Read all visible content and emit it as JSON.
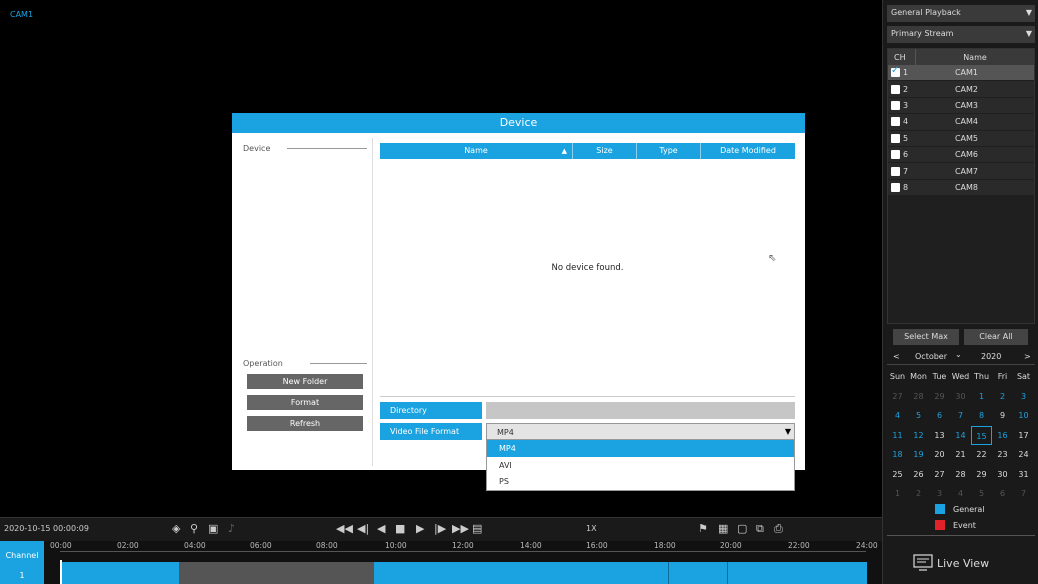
{
  "video": {
    "cam_label": "CAM1"
  },
  "right_panel": {
    "playback_mode": "General Playback",
    "stream": "Primary Stream",
    "table_headers": {
      "ch": "CH",
      "name": "Name"
    },
    "channels": [
      {
        "num": "1",
        "name": "CAM1",
        "checked": true
      },
      {
        "num": "2",
        "name": "CAM2",
        "checked": false
      },
      {
        "num": "3",
        "name": "CAM3",
        "checked": false
      },
      {
        "num": "4",
        "name": "CAM4",
        "checked": false
      },
      {
        "num": "5",
        "name": "CAM5",
        "checked": false
      },
      {
        "num": "6",
        "name": "CAM6",
        "checked": false
      },
      {
        "num": "7",
        "name": "CAM7",
        "checked": false
      },
      {
        "num": "8",
        "name": "CAM8",
        "checked": false
      }
    ],
    "select_max": "Select Max",
    "clear_all": "Clear All",
    "calendar": {
      "prev": "<",
      "month": "October",
      "year": "2020",
      "next": ">",
      "day_headers": [
        "Sun",
        "Mon",
        "Tue",
        "Wed",
        "Thu",
        "Fri",
        "Sat"
      ],
      "days": [
        {
          "d": "27",
          "s": "off"
        },
        {
          "d": "28",
          "s": "off"
        },
        {
          "d": "29",
          "s": "off"
        },
        {
          "d": "30",
          "s": "off"
        },
        {
          "d": "1",
          "s": "blue"
        },
        {
          "d": "2",
          "s": "blue"
        },
        {
          "d": "3",
          "s": "blue"
        },
        {
          "d": "4",
          "s": "blue"
        },
        {
          "d": "5",
          "s": "blue"
        },
        {
          "d": "6",
          "s": "blue"
        },
        {
          "d": "7",
          "s": "blue"
        },
        {
          "d": "8",
          "s": "blue"
        },
        {
          "d": "9",
          "s": "normal"
        },
        {
          "d": "10",
          "s": "blue"
        },
        {
          "d": "11",
          "s": "blue"
        },
        {
          "d": "12",
          "s": "blue"
        },
        {
          "d": "13",
          "s": "normal"
        },
        {
          "d": "14",
          "s": "blue"
        },
        {
          "d": "15",
          "s": "today"
        },
        {
          "d": "16",
          "s": "blue"
        },
        {
          "d": "17",
          "s": "normal"
        },
        {
          "d": "18",
          "s": "blue"
        },
        {
          "d": "19",
          "s": "blue"
        },
        {
          "d": "20",
          "s": "normal"
        },
        {
          "d": "21",
          "s": "normal"
        },
        {
          "d": "22",
          "s": "normal"
        },
        {
          "d": "23",
          "s": "normal"
        },
        {
          "d": "24",
          "s": "normal"
        },
        {
          "d": "25",
          "s": "normal"
        },
        {
          "d": "26",
          "s": "normal"
        },
        {
          "d": "27",
          "s": "normal"
        },
        {
          "d": "28",
          "s": "normal"
        },
        {
          "d": "29",
          "s": "normal"
        },
        {
          "d": "30",
          "s": "normal"
        },
        {
          "d": "31",
          "s": "normal"
        },
        {
          "d": "1",
          "s": "off"
        },
        {
          "d": "2",
          "s": "off"
        },
        {
          "d": "3",
          "s": "off"
        },
        {
          "d": "4",
          "s": "off"
        },
        {
          "d": "5",
          "s": "off"
        },
        {
          "d": "6",
          "s": "off"
        },
        {
          "d": "7",
          "s": "off"
        }
      ]
    },
    "legend": {
      "general": "General",
      "event": "Event",
      "general_color": "#1aa3e0",
      "event_color": "#e0222a"
    },
    "live_view": "Live View"
  },
  "toolbar": {
    "datetime": "2020-10-15 00:00:09",
    "speed": "1X"
  },
  "timeline": {
    "channel_label": "Channel",
    "channel_num": "1",
    "ticks": [
      "00:00",
      "02:00",
      "04:00",
      "06:00",
      "08:00",
      "10:00",
      "12:00",
      "14:00",
      "16:00",
      "18:00",
      "20:00",
      "22:00",
      "24:00"
    ]
  },
  "dialog": {
    "title": "Device",
    "device_group": "Device",
    "operation_group": "Operation",
    "new_folder": "New Folder",
    "format": "Format",
    "refresh": "Refresh",
    "columns": {
      "name": "Name",
      "size": "Size",
      "type": "Type",
      "date_modified": "Date Modified"
    },
    "empty_message": "No device found.",
    "directory_label": "Directory",
    "directory_value": "",
    "video_format_label": "Video File Format",
    "video_format_value": "MP4",
    "video_format_options": [
      "MP4",
      "AVI",
      "PS"
    ]
  }
}
